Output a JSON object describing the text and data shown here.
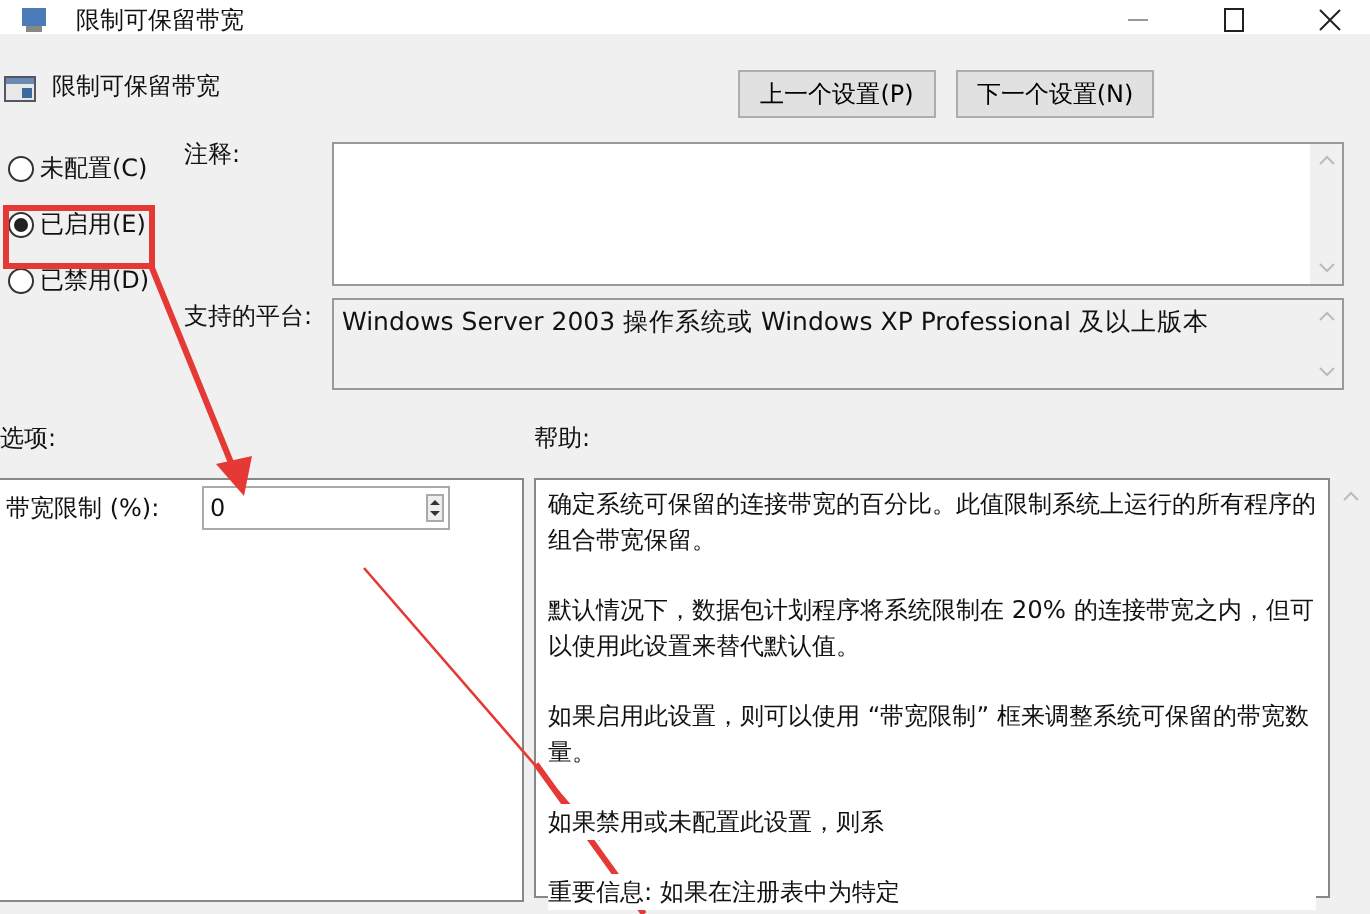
{
  "window": {
    "title": "限制可保留带宽"
  },
  "header": {
    "title": "限制可保留带宽"
  },
  "nav_buttons": [
    "上一个设置(P)",
    "下一个设置(N)"
  ],
  "state_options": [
    {
      "label": "未配置(C)",
      "selected": false
    },
    {
      "label": "已启用(E)",
      "selected": true
    },
    {
      "label": "已禁用(D)",
      "selected": false
    }
  ],
  "comment": {
    "label": "注释:"
  },
  "platform": {
    "label": "支持的平台:",
    "value": "Windows Server 2003 操作系统或 Windows XP Professional 及以上版本"
  },
  "options": {
    "label": "选项:",
    "fields": [
      {
        "label": "带宽限制 (%):",
        "value": "0"
      }
    ]
  },
  "help": {
    "label": "帮助:",
    "paragraphs": [
      "确定系统可保留的连接带宽的百分比。此值限制系统上运行的所有程序的组合带宽保留。",
      "默认情况下，数据包计划程序将系统限制在 20% 的连接带宽之内，但可以使用此设置来替代默认值。",
      "如果启用此设置，则可以使用 “带宽限制” 框来调整系统可保留的带宽数量。",
      "如果禁用或未配置此设置，则系",
      "重要信息: 如果在注册表中为特定"
    ]
  }
}
